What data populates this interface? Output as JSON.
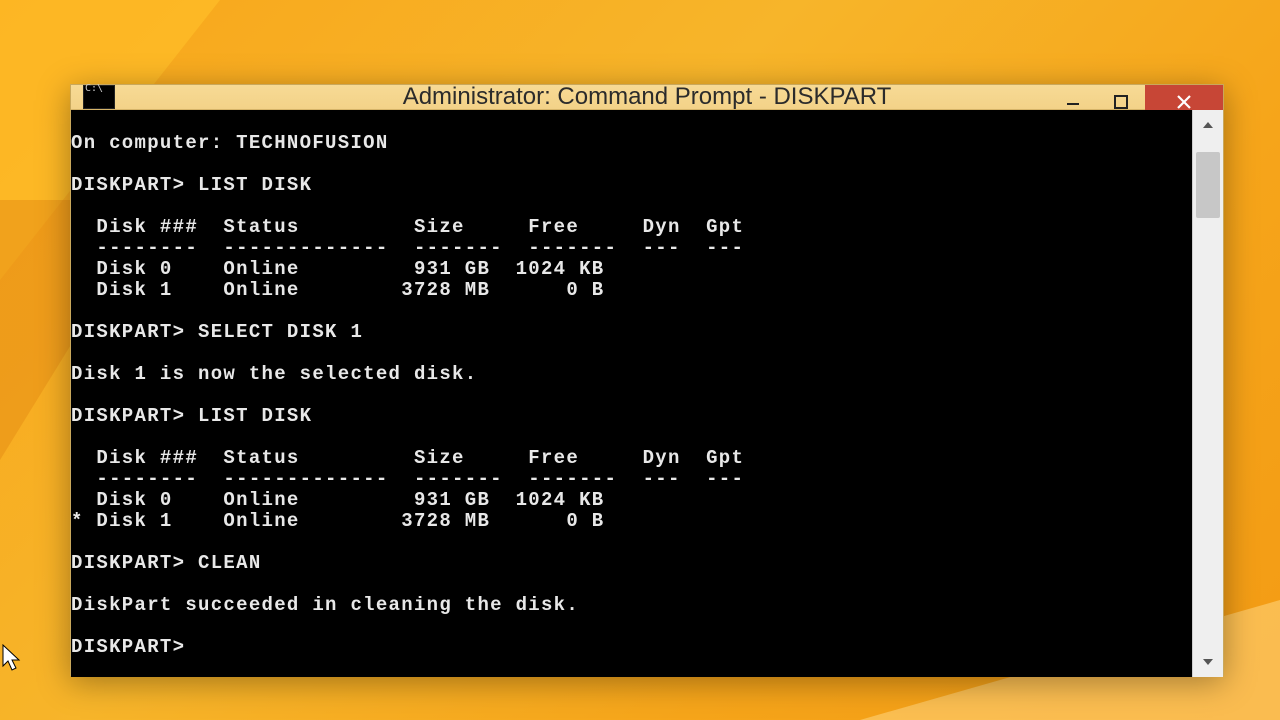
{
  "window": {
    "title": "Administrator: Command Prompt - DISKPART"
  },
  "terminal": {
    "computer_label": "On computer:",
    "computer_name": "TECHNOFUSION",
    "prompt": "DISKPART>",
    "cmd_list_disk": "LIST DISK",
    "cmd_select_disk": "SELECT DISK 1",
    "cmd_clean": "CLEAN",
    "msg_selected": "Disk 1 is now the selected disk.",
    "msg_clean_succeeded": "DiskPart succeeded in cleaning the disk.",
    "table1": {
      "hdr_disk": "Disk ###",
      "hdr_status": "Status",
      "hdr_size": "Size",
      "hdr_free": "Free",
      "hdr_dyn": "Dyn",
      "hdr_gpt": "Gpt",
      "sep_disk": "--------",
      "sep_status": "-------------",
      "sep_size": "-------",
      "sep_free": "-------",
      "sep_dyn": "---",
      "sep_gpt": "---",
      "rows": [
        {
          "sel": " ",
          "disk": "Disk 0",
          "status": "Online",
          "size": "931 GB",
          "free": "1024 KB"
        },
        {
          "sel": " ",
          "disk": "Disk 1",
          "status": "Online",
          "size": "3728 MB",
          "free": "0 B"
        }
      ]
    },
    "table2": {
      "rows": [
        {
          "sel": " ",
          "disk": "Disk 0",
          "status": "Online",
          "size": "931 GB",
          "free": "1024 KB"
        },
        {
          "sel": "*",
          "disk": "Disk 1",
          "status": "Online",
          "size": "3728 MB",
          "free": "0 B"
        }
      ]
    }
  }
}
